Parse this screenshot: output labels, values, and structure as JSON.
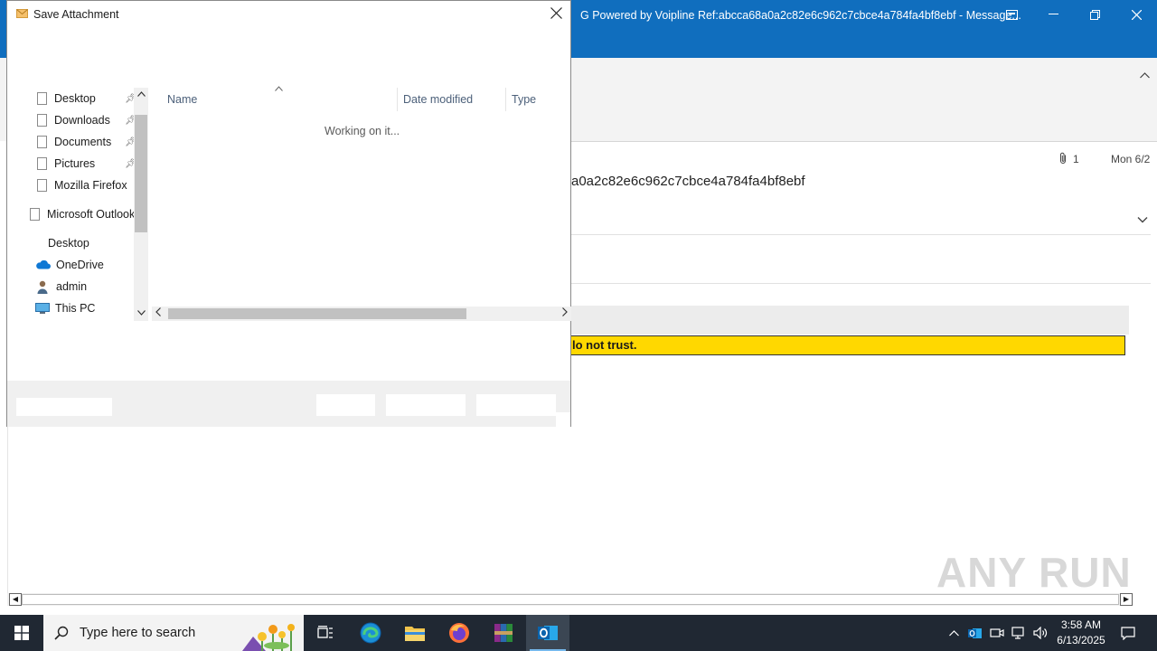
{
  "outlook": {
    "window_title": "G Powered by Voipline Ref:abcca68a0a2c82e6c962c7cbce4a784fa4bf8ebf  -  Message...",
    "attachment_count": "1",
    "date": "Mon 6/2",
    "subject_partial": "a0a2c82e6c962c7cbce4a784fa4bf8ebf",
    "warning_partial": "lo not trust.",
    "watermark": "ANY RUN",
    "brand_color": "#106ebe",
    "warning_color": "#ffd800"
  },
  "dialog": {
    "title": "Save Attachment",
    "nav_items": [
      {
        "label": "Desktop",
        "pinned": true
      },
      {
        "label": "Downloads",
        "pinned": true
      },
      {
        "label": "Documents",
        "pinned": true
      },
      {
        "label": "Pictures",
        "pinned": true
      },
      {
        "label": "Mozilla Firefox",
        "pinned": false
      },
      {
        "label": "Microsoft Outlook",
        "pinned": false
      },
      {
        "label": "Desktop",
        "pinned": false
      },
      {
        "label": "OneDrive",
        "pinned": false
      },
      {
        "label": "admin",
        "pinned": false
      },
      {
        "label": "This PC",
        "pinned": false
      }
    ],
    "columns": {
      "name": "Name",
      "date_modified": "Date modified",
      "type": "Type"
    },
    "status": "Working on it..."
  },
  "taskbar": {
    "search_placeholder": "Type here to search",
    "time": "3:58 AM",
    "date": "6/13/2025",
    "apps": [
      "task-view",
      "edge",
      "file-explorer",
      "firefox",
      "winrar",
      "outlook"
    ]
  }
}
